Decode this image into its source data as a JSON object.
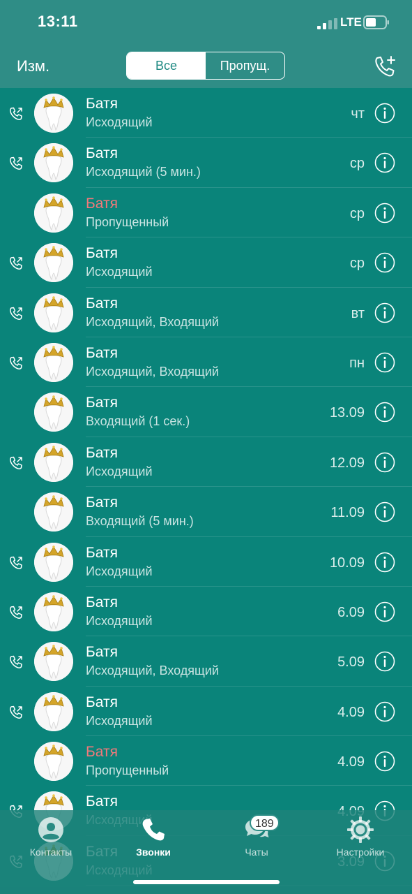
{
  "status": {
    "time": "13:11",
    "network": "LTE"
  },
  "nav": {
    "edit_label": "Изм.",
    "seg_all": "Все",
    "seg_missed": "Пропущ."
  },
  "calls": [
    {
      "name": "Батя",
      "detail": "Исходящий",
      "date": "чт",
      "missed": false,
      "outgoing": true
    },
    {
      "name": "Батя",
      "detail": "Исходящий (5 мин.)",
      "date": "ср",
      "missed": false,
      "outgoing": true
    },
    {
      "name": "Батя",
      "detail": "Пропущенный",
      "date": "ср",
      "missed": true,
      "outgoing": false
    },
    {
      "name": "Батя",
      "detail": "Исходящий",
      "date": "ср",
      "missed": false,
      "outgoing": true
    },
    {
      "name": "Батя",
      "detail": "Исходящий, Входящий",
      "date": "вт",
      "missed": false,
      "outgoing": true
    },
    {
      "name": "Батя",
      "detail": "Исходящий, Входящий",
      "date": "пн",
      "missed": false,
      "outgoing": true
    },
    {
      "name": "Батя",
      "detail": "Входящий (1 сек.)",
      "date": "13.09",
      "missed": false,
      "outgoing": false
    },
    {
      "name": "Батя",
      "detail": "Исходящий",
      "date": "12.09",
      "missed": false,
      "outgoing": true
    },
    {
      "name": "Батя",
      "detail": "Входящий (5 мин.)",
      "date": "11.09",
      "missed": false,
      "outgoing": false
    },
    {
      "name": "Батя",
      "detail": "Исходящий",
      "date": "10.09",
      "missed": false,
      "outgoing": true
    },
    {
      "name": "Батя",
      "detail": "Исходящий",
      "date": "6.09",
      "missed": false,
      "outgoing": true
    },
    {
      "name": "Батя",
      "detail": "Исходящий, Входящий",
      "date": "5.09",
      "missed": false,
      "outgoing": true
    },
    {
      "name": "Батя",
      "detail": "Исходящий",
      "date": "4.09",
      "missed": false,
      "outgoing": true
    },
    {
      "name": "Батя",
      "detail": "Пропущенный",
      "date": "4.09",
      "missed": true,
      "outgoing": false
    },
    {
      "name": "Батя",
      "detail": "Исходящий",
      "date": "4.09",
      "missed": false,
      "outgoing": true
    },
    {
      "name": "Батя",
      "detail": "Исходящий",
      "date": "3.09",
      "missed": false,
      "outgoing": true
    }
  ],
  "tabs": [
    {
      "label": "Контакты",
      "icon": "contacts-icon",
      "active": false
    },
    {
      "label": "Звонки",
      "icon": "phone-icon",
      "active": true
    },
    {
      "label": "Чаты",
      "icon": "chats-icon",
      "active": false
    },
    {
      "label": "Настройки",
      "icon": "settings-icon",
      "active": false
    }
  ],
  "chats_badge": "189",
  "colors": {
    "background": "#0a847a",
    "header": "#2f8d86",
    "missed": "#f2797a"
  }
}
